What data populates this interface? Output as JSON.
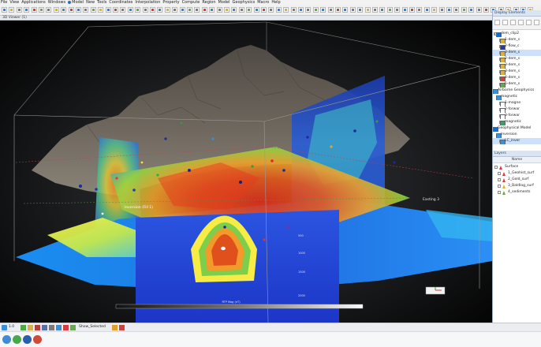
{
  "menu": {
    "items": [
      "File",
      "View",
      "Applications",
      "Windows",
      "Model",
      "New",
      "Tools",
      "Coordinates",
      "Interpolation",
      "Property",
      "Compute",
      "Region",
      "Model",
      "Geophysics",
      "Macro",
      "Help"
    ]
  },
  "viewer": {
    "title": "3D Viewer (1)",
    "annotations": {
      "horizon_label": "Inversion (Fill 1)",
      "x_label": "Easting 3",
      "depth_labels": [
        "500",
        "1000",
        "1500",
        "2000"
      ],
      "colorbar_label": "RTP Mag (nT)"
    }
  },
  "display_panel": {
    "title": "Display Elements",
    "tree": [
      {
        "label": "dem_clip2"
      },
      {
        "label": "1-dem_s"
      },
      {
        "label": "2-flow_c"
      },
      {
        "label": "3-dem_s"
      },
      {
        "label": "2-dem_s"
      },
      {
        "label": "3-dem_s"
      },
      {
        "label": "3-dem_s"
      },
      {
        "label": "4-dem_s"
      },
      {
        "label": "5-dem_s"
      },
      {
        "label": "Airborne Geophysics"
      },
      {
        "label": "magnetic"
      },
      {
        "label": "1-magne"
      },
      {
        "label": "2-forwar"
      },
      {
        "label": "3-forwar"
      },
      {
        "label": "magnetic"
      },
      {
        "label": "Geophysical Model"
      },
      {
        "label": "Inversion"
      },
      {
        "label": "LC_inver"
      }
    ]
  },
  "layers_panel": {
    "title": "Layers",
    "column": "Name",
    "rows": [
      {
        "label": "Surface"
      },
      {
        "label": "1_Geohist_surf"
      },
      {
        "label": "2_Gold_surf"
      },
      {
        "label": "3_Baldlog_surf"
      },
      {
        "label": "4_sediments"
      }
    ]
  },
  "statusbar": {
    "zoom": "1.0",
    "show_selected": "Show_Selected"
  },
  "colors": {
    "accent": "#2a6fba",
    "viewport_bg": "#000000"
  }
}
